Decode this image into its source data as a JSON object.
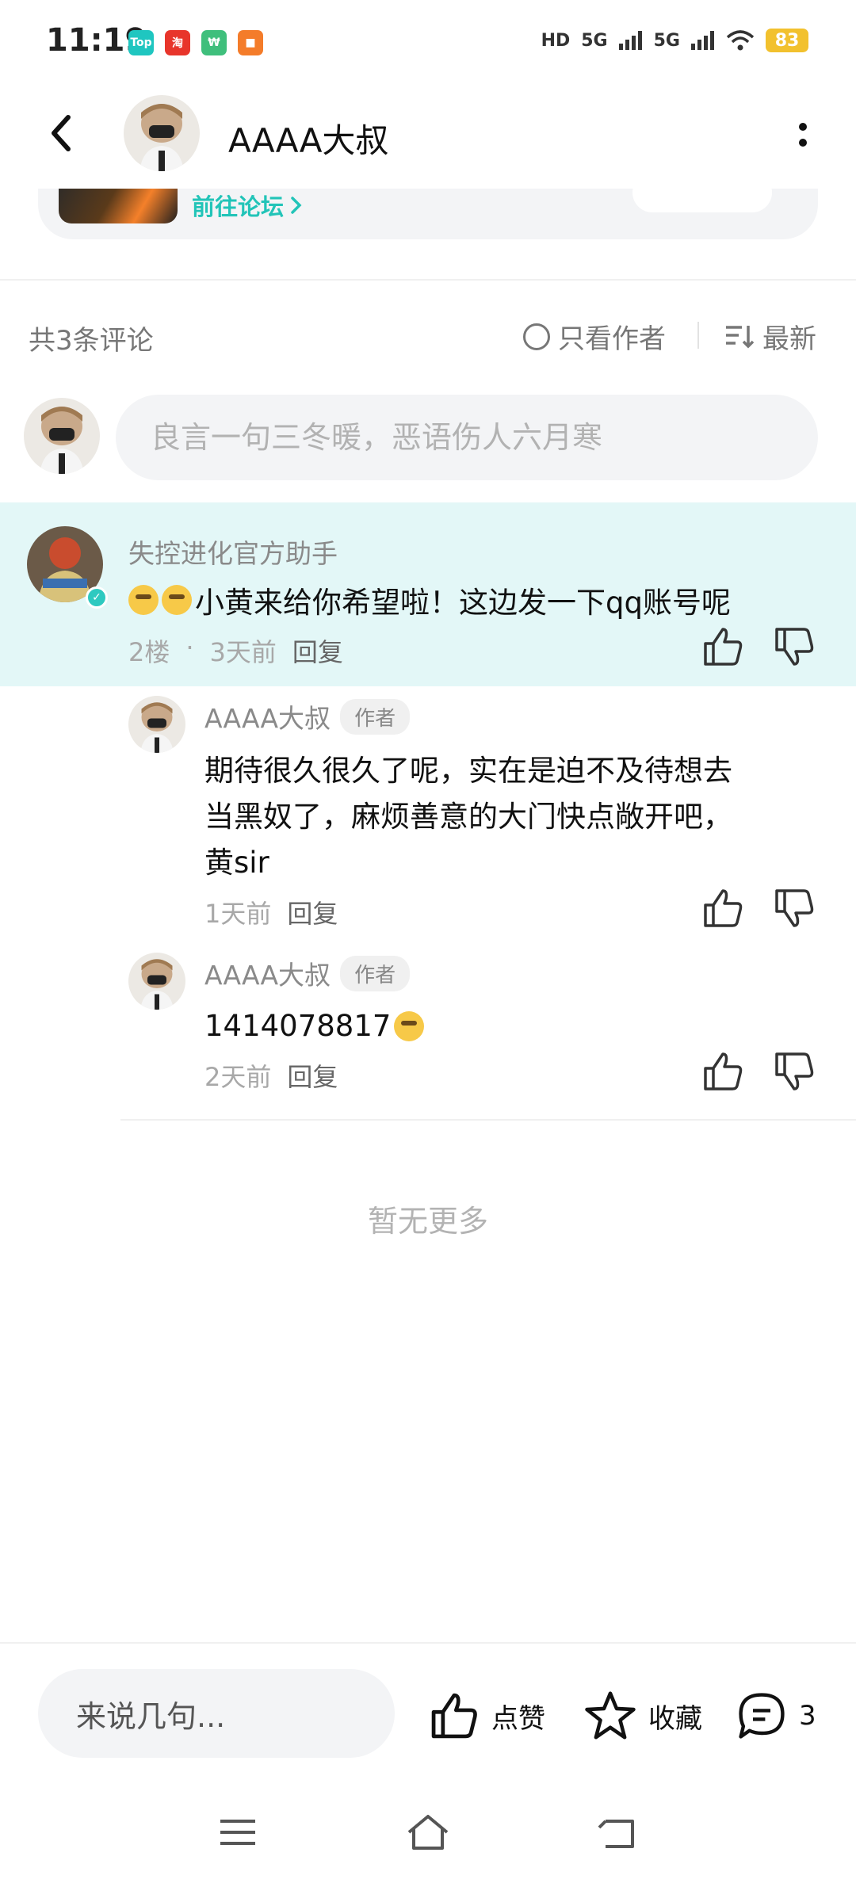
{
  "status_bar": {
    "time": "11:19",
    "apps": [
      {
        "name": "Top",
        "color": "#1fc6c0"
      },
      {
        "name": "淘",
        "color": "#e8352b"
      },
      {
        "name": "₩",
        "color": "#3fbf7c"
      },
      {
        "name": "■",
        "color": "#f47c2a"
      }
    ],
    "hd_label": "HD",
    "signal1_label": "5G",
    "signal2_label": "5G",
    "battery": "83"
  },
  "header": {
    "title": "AAAA大叔"
  },
  "forum_card": {
    "link_label": "前往论坛"
  },
  "comments_header": {
    "count_label": "共3条评论",
    "author_only_label": "只看作者",
    "sort_label": "最新"
  },
  "comment_input": {
    "placeholder": "良言一句三冬暖，恶语伤人六月寒"
  },
  "main_comment": {
    "author": "失控进化官方助手",
    "text": "小黄来给你希望啦！这边发一下qq账号呢",
    "floor": "2楼",
    "dot": "·",
    "time": "3天前",
    "reply_label": "回复"
  },
  "replies": [
    {
      "author": "AAAA大叔",
      "tag": "作者",
      "text_lines": [
        "期待很久很久了呢，实在是迫不及待想去",
        "当黑奴了，麻烦善意的大门快点敞开吧，",
        "黄sir"
      ],
      "time": "1天前",
      "reply_label": "回复"
    },
    {
      "author": "AAAA大叔",
      "tag": "作者",
      "text": "1414078817",
      "time": "2天前",
      "reply_label": "回复"
    }
  ],
  "no_more": "暂无更多",
  "bottom_bar": {
    "input_label": "来说几句...",
    "like_label": "点赞",
    "fav_label": "收藏",
    "comment_count": "3"
  },
  "colors": {
    "accent": "#22c4b8",
    "highlight_bg": "#e3f7f7"
  }
}
